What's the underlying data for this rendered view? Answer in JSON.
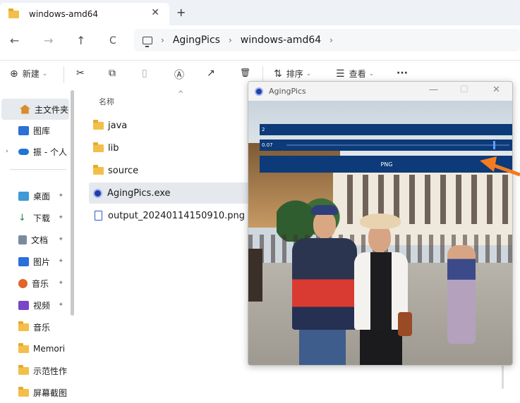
{
  "tabbar": {
    "tab_title": "windows-amd64",
    "close_glyph": "✕",
    "new_tab_glyph": "+"
  },
  "nav": {
    "back_glyph": "←",
    "forward_glyph": "→",
    "up_glyph": "↑",
    "refresh_glyph": "C",
    "breadcrumb": [
      "AgingPics",
      "windows-amd64"
    ]
  },
  "toolbar": {
    "new_label": "新建",
    "new_glyph": "⊕",
    "sort_label": "排序",
    "view_label": "查看",
    "more_glyph": "···",
    "cut_glyph": "✂",
    "copy_glyph": "⧉",
    "paste_glyph": "▯",
    "rename_glyph": "Ⓐ",
    "share_glyph": "↗",
    "delete_glyph": "🗑",
    "sort_glyph": "⇅",
    "view_glyph": "☰"
  },
  "sidebar": {
    "items": [
      {
        "label": "主文件夹",
        "icon": "home-icon",
        "color": "#d98c2b"
      },
      {
        "label": "图库",
        "icon": "gallery-icon",
        "color": "#2b6fd9"
      },
      {
        "label": "振 - 个人",
        "icon": "cloud-icon",
        "color": "#1f74d6"
      },
      {
        "label": "桌面",
        "icon": "desktop-icon",
        "color": "#3f9ad6"
      },
      {
        "label": "下载",
        "icon": "download-icon",
        "color": "#2a8a4a"
      },
      {
        "label": "文档",
        "icon": "document-icon",
        "color": "#7c8aa0"
      },
      {
        "label": "图片",
        "icon": "pictures-icon",
        "color": "#2b6fd9"
      },
      {
        "label": "音乐",
        "icon": "music-icon",
        "color": "#e2632b"
      },
      {
        "label": "视频",
        "icon": "video-icon",
        "color": "#7a45c9"
      },
      {
        "label": "音乐",
        "icon": "folder-icon",
        "color": "#f2c04a"
      },
      {
        "label": "Memori",
        "icon": "folder-icon",
        "color": "#f2c04a"
      },
      {
        "label": "示范性作",
        "icon": "folder-icon",
        "color": "#f2c04a"
      },
      {
        "label": "屏幕截图",
        "icon": "folder-icon",
        "color": "#f2c04a"
      }
    ],
    "pin_glyph": "📌",
    "expander_glyph": "›"
  },
  "filelist": {
    "column_name": "名称",
    "sort_caret": "^",
    "files": [
      {
        "name": "java",
        "type": "folder"
      },
      {
        "name": "lib",
        "type": "folder"
      },
      {
        "name": "source",
        "type": "folder"
      },
      {
        "name": "AgingPics.exe",
        "type": "exe"
      },
      {
        "name": "output_20240114150910.png",
        "type": "png"
      }
    ]
  },
  "app": {
    "title": "AgingPics",
    "minimize_glyph": "—",
    "maximize_glyph": "☐",
    "close_glyph": "✕",
    "field1_value": "2",
    "field2_value": "0.07",
    "format_value": "PNG",
    "slider_fraction": 0.93,
    "accent": "#0d3a78"
  },
  "arrow": {
    "color": "#f47b20"
  }
}
